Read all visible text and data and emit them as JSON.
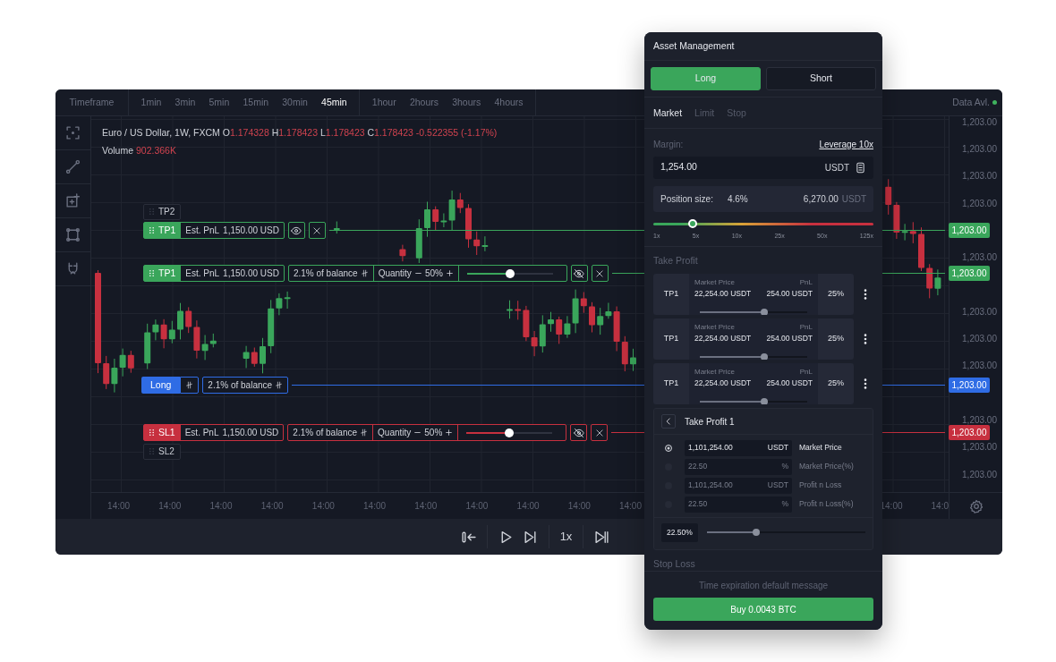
{
  "toolbar": {
    "title": "Timeframe",
    "groups": [
      [
        {
          "label": "1min",
          "selected": false
        },
        {
          "label": "3min",
          "selected": false
        },
        {
          "label": "5min",
          "selected": false
        },
        {
          "label": "15min",
          "selected": false
        },
        {
          "label": "30min",
          "selected": false
        },
        {
          "label": "45min",
          "selected": true
        }
      ],
      [
        {
          "label": "1hour",
          "selected": false
        },
        {
          "label": "2hours",
          "selected": false
        },
        {
          "label": "3hours",
          "selected": false
        },
        {
          "label": "4hours",
          "selected": false
        }
      ]
    ],
    "data_status": "Data Avl."
  },
  "chart": {
    "symbol": "Euro / US Dollar, 1W, FXCM",
    "ohlc": [
      {
        "label": "O",
        "value": "1.174328"
      },
      {
        "label": "H",
        "value": "1.178423"
      },
      {
        "label": "L",
        "value": "1.178423"
      },
      {
        "label": "C",
        "value": "1.178423"
      }
    ],
    "change": "-0.522355 (-1.17%)",
    "volume_label": "Volume",
    "volume": "902.366K"
  },
  "order_lines": [
    {
      "kind": "ghost",
      "label": "TP2"
    },
    {
      "kind": "order",
      "label": "TP1",
      "color": "#3aa65b",
      "pnl_label": "Est. PnL",
      "pnl": "1,150.00 USD",
      "expanded": false,
      "visible": true,
      "price": "1,203.00"
    },
    {
      "kind": "order",
      "label": "TP1",
      "color": "#3aa65b",
      "pnl_label": "Est. PnL",
      "pnl": "1,150.00 USD",
      "expanded": true,
      "visible": false,
      "balance": "2.1% of balance",
      "quantity_label": "Quantity",
      "quantity": "50%",
      "level": 0.5,
      "price": "1,203.00"
    },
    {
      "kind": "entry",
      "label": "Long",
      "color": "#2f6ce5",
      "balance": "2.1% of balance",
      "price": "1,203.00"
    },
    {
      "kind": "order",
      "label": "SL1",
      "color": "#c7303f",
      "pnl_label": "Est. PnL",
      "pnl": "1,150.00 USD",
      "expanded": true,
      "visible": false,
      "balance": "2.1% of balance",
      "quantity_label": "Quantity",
      "quantity": "50%",
      "level": 0.5,
      "price": "1,203.00"
    },
    {
      "kind": "ghost",
      "label": "SL2"
    }
  ],
  "price_axis": {
    "labels": [
      "1,203.00",
      "1,203.00",
      "1,203.00",
      "1,203.00",
      "1,203.00",
      "1,203.00",
      "1,203.00",
      "1,203.00",
      "1,203.00",
      "1,203.00",
      "1,203.00"
    ]
  },
  "time_axis": {
    "left_labels": [
      "14:00",
      "14:00",
      "14:00",
      "14:00",
      "14:00",
      "14:00",
      "14:00",
      "14:00",
      "14:00",
      "14:00",
      "14:00"
    ],
    "right_labels": [
      "14:00",
      "14:0"
    ]
  },
  "playback": {
    "speed": "1x"
  },
  "panel": {
    "title": "Asset Management",
    "sides": [
      {
        "label": "Long",
        "selected": true
      },
      {
        "label": "Short",
        "selected": false
      }
    ],
    "order_types": [
      {
        "label": "Market",
        "selected": true
      },
      {
        "label": "Limit",
        "selected": false
      },
      {
        "label": "Stop",
        "selected": false
      }
    ],
    "margin": {
      "label": "Margin:",
      "leverage_link": "Leverage 10x",
      "value": "1,254.00",
      "unit": "USDT"
    },
    "position": {
      "label": "Position size:",
      "percent": "4.6%",
      "amount": "6,270.00",
      "unit": "USDT"
    },
    "leverage": {
      "level": 0.18,
      "ticks": [
        "1x",
        "5x",
        "10x",
        "25x",
        "50x",
        "125x"
      ]
    },
    "take_profit": {
      "title": "Take Profit",
      "targets": [
        {
          "label": "TP1",
          "price_label": "Market Price",
          "price": "22,254.00 USDT",
          "pnl_label": "PnL",
          "pnl": "254.00 USDT",
          "level": 0.6,
          "share": "25%"
        },
        {
          "label": "TP1",
          "price_label": "Market Price",
          "price": "22,254.00 USDT",
          "pnl_label": "PnL",
          "pnl": "254.00 USDT",
          "level": 0.6,
          "share": "25%"
        },
        {
          "label": "TP1",
          "price_label": "Market Price",
          "price": "22,254.00 USDT",
          "pnl_label": "PnL",
          "pnl": "254.00 USDT",
          "level": 0.6,
          "share": "25%"
        }
      ],
      "editor": {
        "title": "Take Profit 1",
        "rows": [
          {
            "value": "1,101,254.00",
            "unit": "USDT",
            "label": "Market Price",
            "selected": true
          },
          {
            "value": "22.50",
            "unit": "%",
            "label": "Market Price(%)",
            "selected": false
          },
          {
            "value": "1,101,254.00",
            "unit": "USDT",
            "label": "Profit n Loss",
            "selected": false
          },
          {
            "value": "22.50",
            "unit": "%",
            "label": "Profit n Loss(%)",
            "selected": false
          }
        ],
        "percent": "22.50%",
        "level": 0.31
      }
    },
    "stop_loss": {
      "title": "Stop Loss"
    },
    "footer": {
      "message": "Time expiration default message",
      "button": "Buy 0.0043 BTC"
    }
  }
}
